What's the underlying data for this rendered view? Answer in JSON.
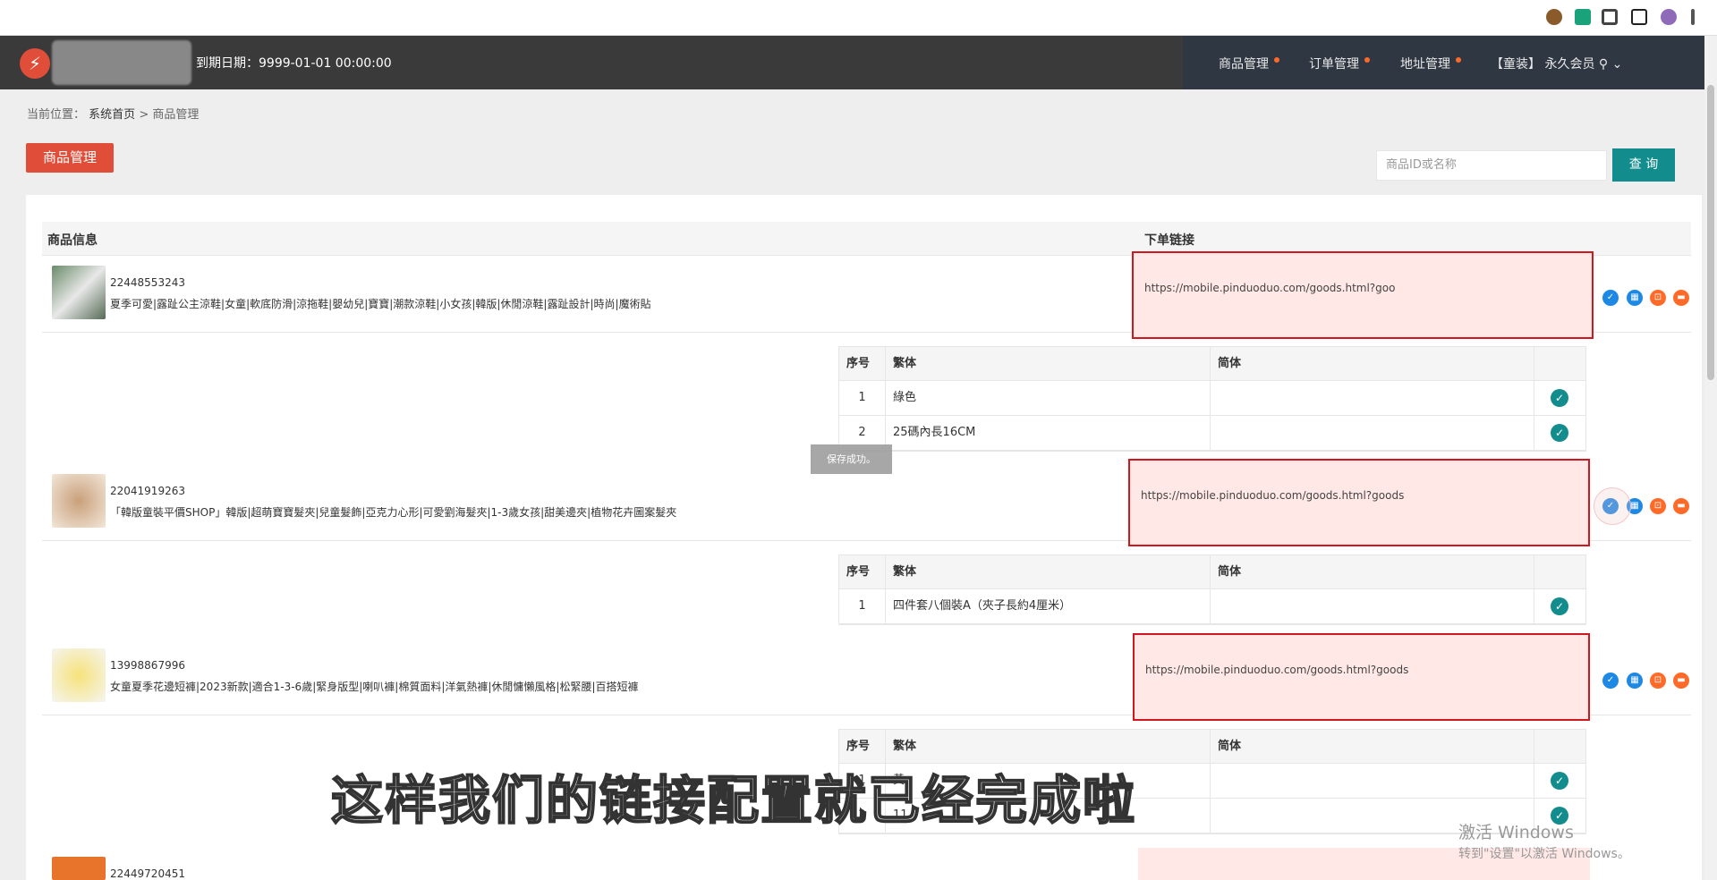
{
  "browser": {
    "extensions": [
      "cookie-icon",
      "extension-green-icon",
      "puzzle-icon",
      "sidebar-icon",
      "profile-icon",
      "menu-icon"
    ]
  },
  "header": {
    "expire_label": "到期日期：9999-01-01 00:00:00",
    "nav": [
      {
        "label": "商品管理"
      },
      {
        "label": "订单管理"
      },
      {
        "label": "地址管理"
      }
    ],
    "user_label": "【童装】 永久会员"
  },
  "breadcrumb": {
    "prefix": "当前位置：",
    "home": "系统首页",
    "sep": ">",
    "current": "商品管理"
  },
  "page": {
    "title": "商品管理",
    "search_placeholder": "商品ID或名称",
    "search_button": "查 询"
  },
  "table": {
    "col_info": "商品信息",
    "col_link": "下单链接",
    "sub_headers": {
      "index": "序号",
      "traditional": "繁体",
      "simplified": "简体"
    },
    "products": [
      {
        "id": "22448553243",
        "name": "夏季可愛|露趾公主涼鞋|女童|軟底防滑|涼拖鞋|嬰幼兒|寶寶|潮款涼鞋|小女孩|韓版|休閒涼鞋|露趾設計|時尚|魔術貼",
        "link": "https://mobile.pinduoduo.com/goods.html?goo",
        "skus": [
          {
            "index": "1",
            "traditional": "綠色",
            "simplified": ""
          },
          {
            "index": "2",
            "traditional": "25碼內長16CM",
            "simplified": ""
          }
        ]
      },
      {
        "id": "22041919263",
        "name": "「韓版童裝平價SHOP」韓版|超萌寶寶髮夾|兒童髮飾|亞克力心形|可愛劉海髮夾|1-3歲女孩|甜美邊夾|植物花卉圖案髮夾",
        "link": "https://mobile.pinduoduo.com/goods.html?goods",
        "skus": [
          {
            "index": "1",
            "traditional": "四件套八個裝A（夾子長約4厘米）",
            "simplified": ""
          }
        ]
      },
      {
        "id": "13998867996",
        "name": "女童夏季花邊短褲|2023新款|適合1-3-6歲|緊身版型|喇叭褲|棉質面料|洋氣熱褲|休閒慵懶風格|松緊腰|百搭短褲",
        "link": "https://mobile.pinduoduo.com/goods.html?goods",
        "skus": [
          {
            "index": "1",
            "traditional": "黃",
            "simplified": ""
          },
          {
            "index": "2",
            "traditional": "11",
            "simplified": ""
          }
        ]
      },
      {
        "id": "22449720451",
        "name": "",
        "link": ""
      }
    ]
  },
  "toast": "保存成功。",
  "overlay_subtitle": "这样我们的链接配置就已经完成啦",
  "watermark": {
    "line1": "激活 Windows",
    "line2": "转到\"设置\"以激活 Windows。"
  }
}
